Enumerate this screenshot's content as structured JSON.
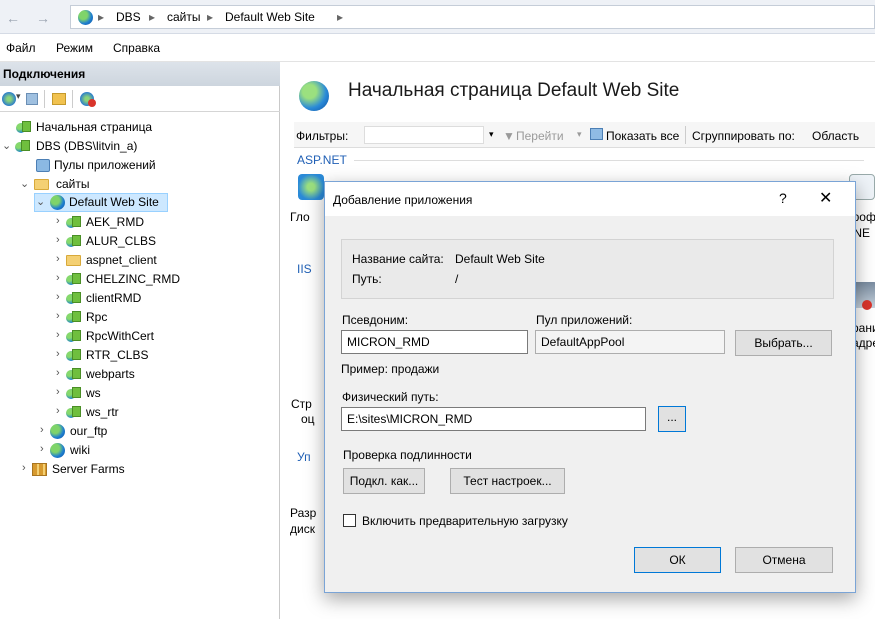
{
  "address": {
    "crumbs": [
      "DBS",
      "сайты",
      "Default Web Site"
    ],
    "separator": "▸"
  },
  "menu": [
    "Файл",
    "Режим",
    "Справка"
  ],
  "connections": {
    "title": "Подключения",
    "tree": [
      {
        "label": "Начальная страница",
        "icon": "start-page-icon"
      },
      {
        "label": "DBS (DBS\\litvin_a)",
        "icon": "server-icon"
      },
      {
        "label": "Пулы приложений",
        "icon": "app-pools-icon"
      },
      {
        "label": "сайты",
        "icon": "sites-folder-icon"
      },
      {
        "label": "Default Web Site",
        "icon": "globe-icon"
      },
      {
        "label": "AEK_RMD",
        "icon": "application-icon"
      },
      {
        "label": "ALUR_CLBS",
        "icon": "application-icon"
      },
      {
        "label": "aspnet_client",
        "icon": "folder-icon"
      },
      {
        "label": "CHELZINC_RMD",
        "icon": "application-icon"
      },
      {
        "label": "clientRMD",
        "icon": "application-icon"
      },
      {
        "label": "Rpc",
        "icon": "application-icon"
      },
      {
        "label": "RpcWithCert",
        "icon": "application-icon"
      },
      {
        "label": "RTR_CLBS",
        "icon": "application-icon"
      },
      {
        "label": "webparts",
        "icon": "application-icon"
      },
      {
        "label": "ws",
        "icon": "application-icon"
      },
      {
        "label": "ws_rtr",
        "icon": "application-icon"
      },
      {
        "label": "our_ftp",
        "icon": "globe-icon"
      },
      {
        "label": "wiki",
        "icon": "globe-icon"
      },
      {
        "label": "Server Farms",
        "icon": "server-farms-icon"
      }
    ]
  },
  "main": {
    "title": "Начальная страница Default Web Site",
    "filter_label": "Фильтры:",
    "go_label": "Перейти",
    "show_all_label": "Показать все",
    "group_by_label": "Сгруппировать по:",
    "group_by_value": "Область",
    "group_aspnet": "ASP.NET",
    "group_iis": "IIS",
    "group_manage": "Уп",
    "partial_texts": {
      "glo": "Гло",
      "prof": "Проф",
      "net": ".NE",
      "prani": "рани",
      "adre": "адре",
      "str": "Стр",
      "ou": "оц",
      "razr": "Разр",
      "disc": "диск"
    }
  },
  "dialog": {
    "title": "Добавление приложения",
    "help": "?",
    "close": "✕",
    "site_name_label": "Название сайта:",
    "site_name_value": "Default Web Site",
    "path_label": "Путь:",
    "path_value": "/",
    "alias_label": "Псевдоним:",
    "alias_value": "MICRON_RMD",
    "alias_example": "Пример: продажи",
    "pool_label": "Пул приложений:",
    "pool_value": "DefaultAppPool",
    "select_button": "Выбрать...",
    "physical_path_label": "Физический путь:",
    "physical_path_value": "E:\\sites\\MICRON_RMD",
    "browse_button": "...",
    "auth_label": "Проверка подлинности",
    "connect_as_button": "Подкл. как...",
    "test_settings_button": "Тест настроек...",
    "preload_label": "Включить предварительную загрузку",
    "preload_checked": false,
    "ok_button": "ОК",
    "cancel_button": "Отмена"
  }
}
